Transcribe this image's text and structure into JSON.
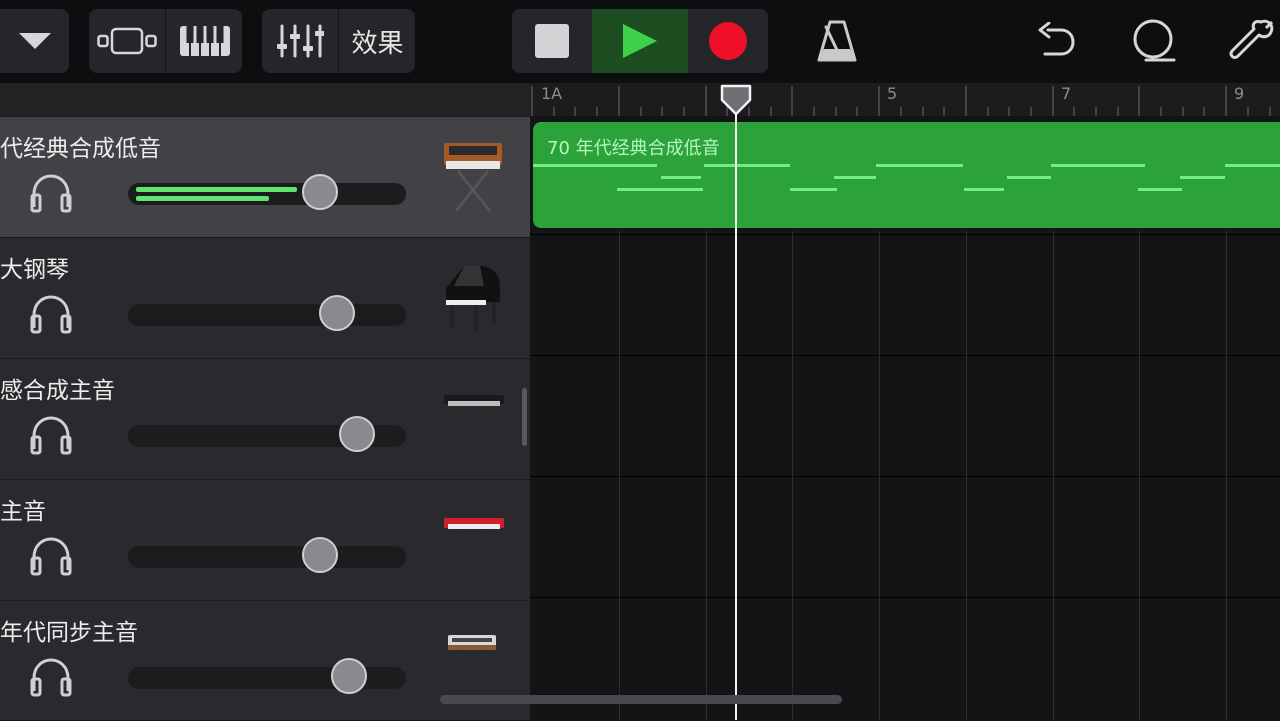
{
  "toolbar": {
    "effects_label": "效果",
    "icons": [
      "chevron-down-icon",
      "track-view-icon",
      "keyboard-icon",
      "mixer-icon",
      "stop-icon",
      "play-icon",
      "record-icon",
      "metronome-icon",
      "undo-icon",
      "loop-icon",
      "wrench-icon"
    ],
    "colors": {
      "play": "#3ed24a",
      "record": "#f0102a",
      "stop": "#d4d4d6"
    }
  },
  "ruler": {
    "labels": [
      "1A",
      "5",
      "7",
      "9"
    ]
  },
  "tracks": [
    {
      "name": "代经典合成低音",
      "volume": 0.72,
      "selected": true,
      "meter": [
        0.58,
        0.48
      ],
      "instrument_icon": "analog-synth-icon"
    },
    {
      "name": "大钢琴",
      "volume": 0.79,
      "selected": false,
      "instrument_icon": "grand-piano-icon"
    },
    {
      "name": "感合成主音",
      "volume": 0.87,
      "selected": false,
      "instrument_icon": "synth-lead-icon"
    },
    {
      "name": "主音",
      "volume": 0.72,
      "selected": false,
      "instrument_icon": "red-keyboard-icon"
    },
    {
      "name": "年代同步主音",
      "volume": 0.84,
      "selected": false,
      "instrument_icon": "sync-synth-icon"
    }
  ],
  "region": {
    "label": "70 年代经典合成低音",
    "color": "#2ba33a"
  }
}
